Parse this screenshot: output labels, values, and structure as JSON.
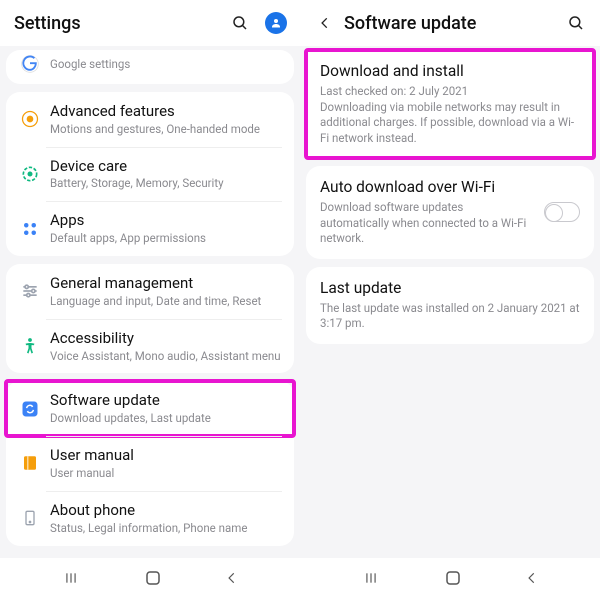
{
  "left": {
    "header": {
      "title": "Settings"
    },
    "google": {
      "sub": "Google settings"
    },
    "items": [
      {
        "label": "Advanced features",
        "sub": "Motions and gestures, One-handed mode"
      },
      {
        "label": "Device care",
        "sub": "Battery, Storage, Memory, Security"
      },
      {
        "label": "Apps",
        "sub": "Default apps, App permissions"
      }
    ],
    "items2": [
      {
        "label": "General management",
        "sub": "Language and input, Date and time, Reset"
      },
      {
        "label": "Accessibility",
        "sub": "Voice Assistant, Mono audio, Assistant menu"
      }
    ],
    "items3": [
      {
        "label": "Software update",
        "sub": "Download updates, Last update"
      },
      {
        "label": "User manual",
        "sub": "User manual"
      },
      {
        "label": "About phone",
        "sub": "Status, Legal information, Phone name"
      }
    ]
  },
  "right": {
    "header": {
      "title": "Software update"
    },
    "download": {
      "label": "Download and install",
      "sub1": "Last checked on: 2 July 2021",
      "sub2": "Downloading via mobile networks may result in additional charges. If possible, download via a Wi-Fi network instead."
    },
    "auto": {
      "label": "Auto download over Wi-Fi",
      "sub": "Download software updates automatically when connected to a Wi-Fi network."
    },
    "last": {
      "label": "Last update",
      "sub": "The last update was installed on 2 January 2021 at 3:17 pm."
    }
  }
}
